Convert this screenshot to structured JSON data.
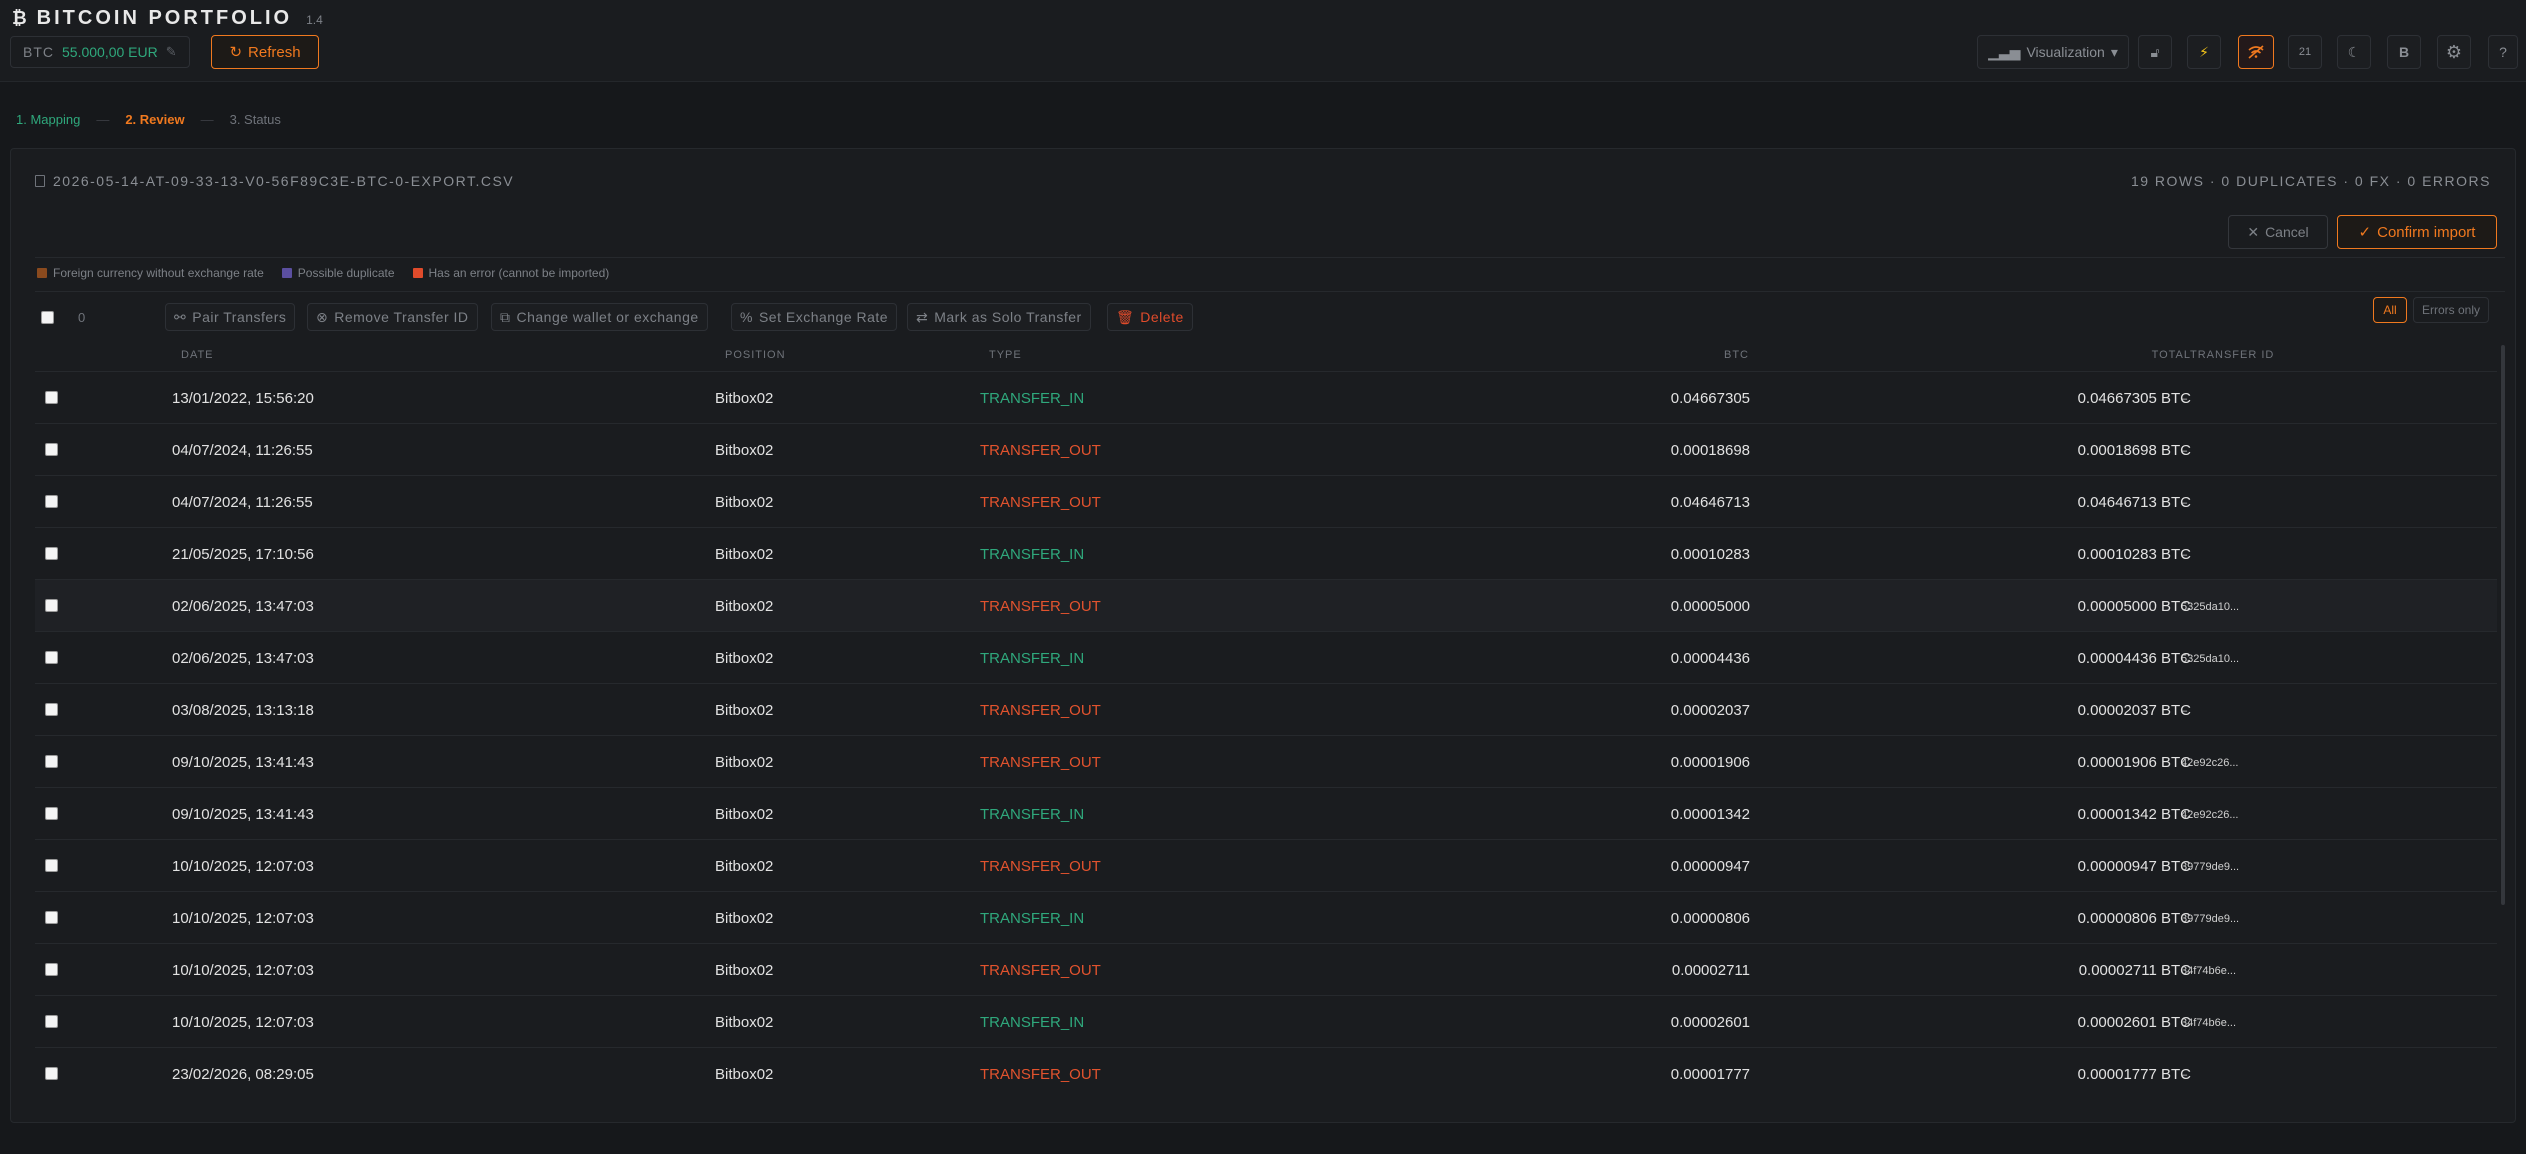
{
  "app": {
    "glyph": "₿",
    "title": "BITCOIN PORTFOLIO",
    "version": "1.4",
    "price_label": "BTC",
    "price_value": "55.000,00 EUR",
    "refresh_label": "Refresh"
  },
  "toolbar": {
    "visualization_label": "Visualization",
    "badge_21": "21",
    "badge_b": "B"
  },
  "steps": [
    {
      "label": "1. Mapping",
      "state": "done"
    },
    {
      "label": "2. Review",
      "state": "active"
    },
    {
      "label": "3. Status",
      "state": "pending"
    }
  ],
  "review": {
    "filename": "2026-05-14-AT-09-33-13-V0-56F89C3E-BTC-0-EXPORT.CSV",
    "stats": "19 ROWS · 0 DUPLICATES · 0 FX · 0 ERRORS",
    "cancel_label": "Cancel",
    "confirm_label": "Confirm import",
    "legend": [
      {
        "label": "Foreign currency without exchange rate",
        "color": "#8a4a1e"
      },
      {
        "label": "Possible duplicate",
        "color": "#5b4fa0"
      },
      {
        "label": "Has an error (cannot be imported)",
        "color": "#e04b2b"
      }
    ],
    "selected_count": "0",
    "actions": {
      "pair": "Pair Transfers",
      "remove_tid": "Remove Transfer ID",
      "change_wallet": "Change wallet or exchange",
      "set_rate": "Set Exchange Rate",
      "solo": "Mark as Solo Transfer",
      "delete": "Delete"
    },
    "filters": {
      "all": "All",
      "errors_only": "Errors only"
    },
    "columns": {
      "date": "DATE",
      "position": "POSITION",
      "type": "TYPE",
      "btc": "BTC",
      "total": "TOTAL",
      "transfer_id": "TRANSFER ID"
    },
    "rows": [
      {
        "date": "13/01/2022, 15:56:20",
        "position": "Bitbox02",
        "type": "TRANSFER_IN",
        "btc": "0.04667305",
        "total": "0.04667305 BTC",
        "tid": "–"
      },
      {
        "date": "04/07/2024, 11:26:55",
        "position": "Bitbox02",
        "type": "TRANSFER_OUT",
        "btc": "0.00018698",
        "total": "0.00018698 BTC",
        "tid": "–"
      },
      {
        "date": "04/07/2024, 11:26:55",
        "position": "Bitbox02",
        "type": "TRANSFER_OUT",
        "btc": "0.04646713",
        "total": "0.04646713 BTC",
        "tid": "–"
      },
      {
        "date": "21/05/2025, 17:10:56",
        "position": "Bitbox02",
        "type": "TRANSFER_IN",
        "btc": "0.00010283",
        "total": "0.00010283 BTC",
        "tid": "–"
      },
      {
        "date": "02/06/2025, 13:47:03",
        "position": "Bitbox02",
        "type": "TRANSFER_OUT",
        "btc": "0.00005000",
        "total": "0.00005000 BTC",
        "tid": "5325da10..."
      },
      {
        "date": "02/06/2025, 13:47:03",
        "position": "Bitbox02",
        "type": "TRANSFER_IN",
        "btc": "0.00004436",
        "total": "0.00004436 BTC",
        "tid": "5325da10..."
      },
      {
        "date": "03/08/2025, 13:13:18",
        "position": "Bitbox02",
        "type": "TRANSFER_OUT",
        "btc": "0.00002037",
        "total": "0.00002037 BTC",
        "tid": "–"
      },
      {
        "date": "09/10/2025, 13:41:43",
        "position": "Bitbox02",
        "type": "TRANSFER_OUT",
        "btc": "0.00001906",
        "total": "0.00001906 BTC",
        "tid": "42e92c26..."
      },
      {
        "date": "09/10/2025, 13:41:43",
        "position": "Bitbox02",
        "type": "TRANSFER_IN",
        "btc": "0.00001342",
        "total": "0.00001342 BTC",
        "tid": "42e92c26..."
      },
      {
        "date": "10/10/2025, 12:07:03",
        "position": "Bitbox02",
        "type": "TRANSFER_OUT",
        "btc": "0.00000947",
        "total": "0.00000947 BTC",
        "tid": "39779de9..."
      },
      {
        "date": "10/10/2025, 12:07:03",
        "position": "Bitbox02",
        "type": "TRANSFER_IN",
        "btc": "0.00000806",
        "total": "0.00000806 BTC",
        "tid": "39779de9..."
      },
      {
        "date": "10/10/2025, 12:07:03",
        "position": "Bitbox02",
        "type": "TRANSFER_OUT",
        "btc": "0.00002711",
        "total": "0.00002711 BTC",
        "tid": "34f74b6e..."
      },
      {
        "date": "10/10/2025, 12:07:03",
        "position": "Bitbox02",
        "type": "TRANSFER_IN",
        "btc": "0.00002601",
        "total": "0.00002601 BTC",
        "tid": "34f74b6e..."
      },
      {
        "date": "23/02/2026, 08:29:05",
        "position": "Bitbox02",
        "type": "TRANSFER_OUT",
        "btc": "0.00001777",
        "total": "0.00001777 BTC",
        "tid": "–"
      }
    ]
  },
  "colors": {
    "accent": "#f0791f",
    "positive": "#2fa87c",
    "negative": "#e2532e",
    "background": "#16181b"
  }
}
